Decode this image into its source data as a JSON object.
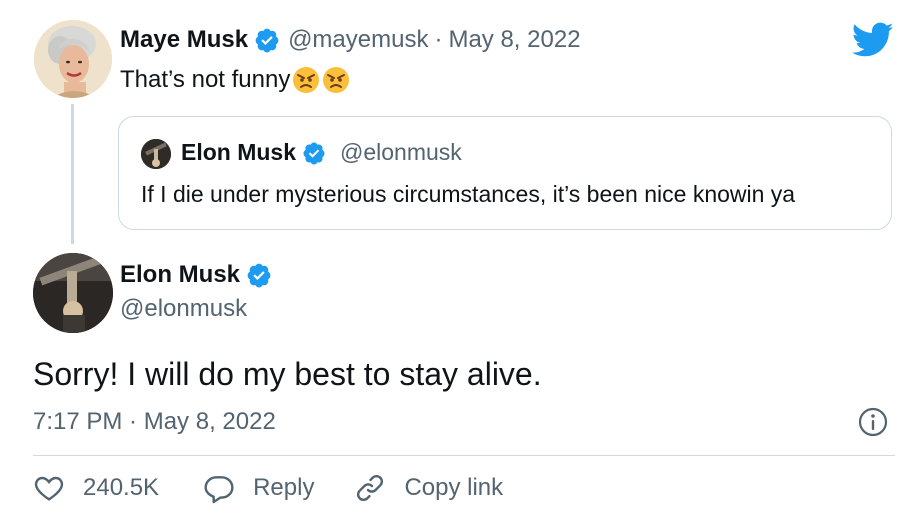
{
  "parent_tweet": {
    "display_name": "Maye Musk",
    "handle": "@mayemusk",
    "separator": "·",
    "date": "May 8, 2022",
    "text": "That’s not funny",
    "emojis": [
      "angry-face-emoji",
      "angry-face-emoji"
    ]
  },
  "quoted_tweet": {
    "display_name": "Elon Musk",
    "handle": "@elonmusk",
    "text": "If I die under mysterious circumstances, it’s been nice knowin ya"
  },
  "main_tweet": {
    "display_name": "Elon Musk",
    "handle": "@elonmusk",
    "text": "Sorry! I will do my best to stay alive.",
    "timestamp": "7:17 PM · May 8, 2022"
  },
  "actions": {
    "like_count": "240.5K",
    "reply_label": "Reply",
    "copy_link_label": "Copy link"
  },
  "icons": {
    "brand": "twitter-bird-icon",
    "verified": "verified-badge-icon",
    "info": "info-icon",
    "like": "heart-icon",
    "reply": "reply-bubble-icon",
    "copy": "link-icon"
  },
  "colors": {
    "brand_blue": "#1d9bf0",
    "text_primary": "#0f1419",
    "text_secondary": "#536471",
    "border": "#cfd9de",
    "emoji_yellow": "#fbbf3a"
  }
}
